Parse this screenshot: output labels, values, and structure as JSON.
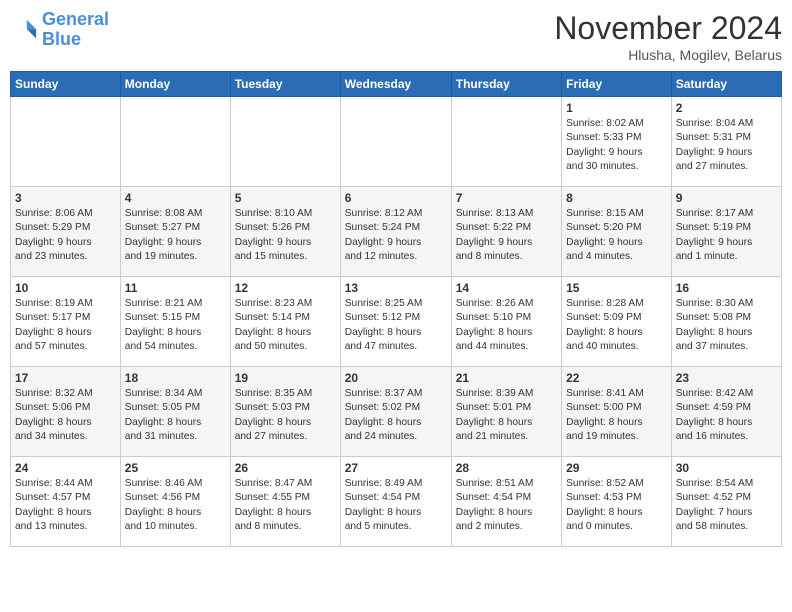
{
  "header": {
    "logo_line1": "General",
    "logo_line2": "Blue",
    "month": "November 2024",
    "location": "Hlusha, Mogilev, Belarus"
  },
  "weekdays": [
    "Sunday",
    "Monday",
    "Tuesday",
    "Wednesday",
    "Thursday",
    "Friday",
    "Saturday"
  ],
  "weeks": [
    [
      {
        "day": "",
        "info": ""
      },
      {
        "day": "",
        "info": ""
      },
      {
        "day": "",
        "info": ""
      },
      {
        "day": "",
        "info": ""
      },
      {
        "day": "",
        "info": ""
      },
      {
        "day": "1",
        "info": "Sunrise: 8:02 AM\nSunset: 5:33 PM\nDaylight: 9 hours\nand 30 minutes."
      },
      {
        "day": "2",
        "info": "Sunrise: 8:04 AM\nSunset: 5:31 PM\nDaylight: 9 hours\nand 27 minutes."
      }
    ],
    [
      {
        "day": "3",
        "info": "Sunrise: 8:06 AM\nSunset: 5:29 PM\nDaylight: 9 hours\nand 23 minutes."
      },
      {
        "day": "4",
        "info": "Sunrise: 8:08 AM\nSunset: 5:27 PM\nDaylight: 9 hours\nand 19 minutes."
      },
      {
        "day": "5",
        "info": "Sunrise: 8:10 AM\nSunset: 5:26 PM\nDaylight: 9 hours\nand 15 minutes."
      },
      {
        "day": "6",
        "info": "Sunrise: 8:12 AM\nSunset: 5:24 PM\nDaylight: 9 hours\nand 12 minutes."
      },
      {
        "day": "7",
        "info": "Sunrise: 8:13 AM\nSunset: 5:22 PM\nDaylight: 9 hours\nand 8 minutes."
      },
      {
        "day": "8",
        "info": "Sunrise: 8:15 AM\nSunset: 5:20 PM\nDaylight: 9 hours\nand 4 minutes."
      },
      {
        "day": "9",
        "info": "Sunrise: 8:17 AM\nSunset: 5:19 PM\nDaylight: 9 hours\nand 1 minute."
      }
    ],
    [
      {
        "day": "10",
        "info": "Sunrise: 8:19 AM\nSunset: 5:17 PM\nDaylight: 8 hours\nand 57 minutes."
      },
      {
        "day": "11",
        "info": "Sunrise: 8:21 AM\nSunset: 5:15 PM\nDaylight: 8 hours\nand 54 minutes."
      },
      {
        "day": "12",
        "info": "Sunrise: 8:23 AM\nSunset: 5:14 PM\nDaylight: 8 hours\nand 50 minutes."
      },
      {
        "day": "13",
        "info": "Sunrise: 8:25 AM\nSunset: 5:12 PM\nDaylight: 8 hours\nand 47 minutes."
      },
      {
        "day": "14",
        "info": "Sunrise: 8:26 AM\nSunset: 5:10 PM\nDaylight: 8 hours\nand 44 minutes."
      },
      {
        "day": "15",
        "info": "Sunrise: 8:28 AM\nSunset: 5:09 PM\nDaylight: 8 hours\nand 40 minutes."
      },
      {
        "day": "16",
        "info": "Sunrise: 8:30 AM\nSunset: 5:08 PM\nDaylight: 8 hours\nand 37 minutes."
      }
    ],
    [
      {
        "day": "17",
        "info": "Sunrise: 8:32 AM\nSunset: 5:06 PM\nDaylight: 8 hours\nand 34 minutes."
      },
      {
        "day": "18",
        "info": "Sunrise: 8:34 AM\nSunset: 5:05 PM\nDaylight: 8 hours\nand 31 minutes."
      },
      {
        "day": "19",
        "info": "Sunrise: 8:35 AM\nSunset: 5:03 PM\nDaylight: 8 hours\nand 27 minutes."
      },
      {
        "day": "20",
        "info": "Sunrise: 8:37 AM\nSunset: 5:02 PM\nDaylight: 8 hours\nand 24 minutes."
      },
      {
        "day": "21",
        "info": "Sunrise: 8:39 AM\nSunset: 5:01 PM\nDaylight: 8 hours\nand 21 minutes."
      },
      {
        "day": "22",
        "info": "Sunrise: 8:41 AM\nSunset: 5:00 PM\nDaylight: 8 hours\nand 19 minutes."
      },
      {
        "day": "23",
        "info": "Sunrise: 8:42 AM\nSunset: 4:59 PM\nDaylight: 8 hours\nand 16 minutes."
      }
    ],
    [
      {
        "day": "24",
        "info": "Sunrise: 8:44 AM\nSunset: 4:57 PM\nDaylight: 8 hours\nand 13 minutes."
      },
      {
        "day": "25",
        "info": "Sunrise: 8:46 AM\nSunset: 4:56 PM\nDaylight: 8 hours\nand 10 minutes."
      },
      {
        "day": "26",
        "info": "Sunrise: 8:47 AM\nSunset: 4:55 PM\nDaylight: 8 hours\nand 8 minutes."
      },
      {
        "day": "27",
        "info": "Sunrise: 8:49 AM\nSunset: 4:54 PM\nDaylight: 8 hours\nand 5 minutes."
      },
      {
        "day": "28",
        "info": "Sunrise: 8:51 AM\nSunset: 4:54 PM\nDaylight: 8 hours\nand 2 minutes."
      },
      {
        "day": "29",
        "info": "Sunrise: 8:52 AM\nSunset: 4:53 PM\nDaylight: 8 hours\nand 0 minutes."
      },
      {
        "day": "30",
        "info": "Sunrise: 8:54 AM\nSunset: 4:52 PM\nDaylight: 7 hours\nand 58 minutes."
      }
    ]
  ]
}
